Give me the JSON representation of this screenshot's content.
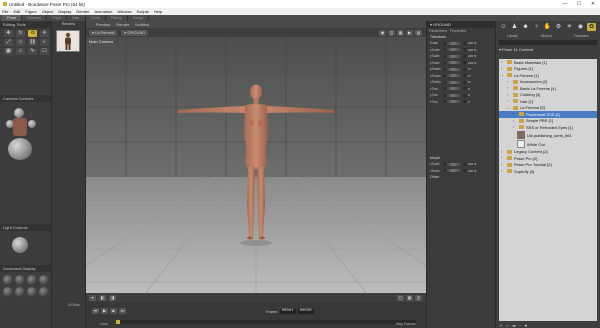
{
  "window": {
    "title": "Untitled - Bondware Poser Pro (64 bit)",
    "controls": [
      "—",
      "☐",
      "✕"
    ]
  },
  "menu": [
    "File",
    "Edit",
    "Figure",
    "Object",
    "Display",
    "Render",
    "Animation",
    "Window",
    "Scripts",
    "Help"
  ],
  "rooms": [
    "Pose",
    "Material",
    "Face",
    "Hair",
    "Cloth",
    "Fitting",
    "Setup"
  ],
  "left": {
    "editing_tools": "Editing Tools",
    "camera_controls": "Camera Controls",
    "light_controls": "Light Controls",
    "document_display": "Document Display"
  },
  "library_thumb_label": "Renders",
  "viewport": {
    "tabs": [
      "Preview",
      "Render",
      "Untitled"
    ],
    "figure": "La Femme",
    "body_part": "GROUND",
    "camera": "Main Camera",
    "frame_label": "Frame",
    "frame_value": "00001",
    "frame_total": "00030",
    "loop": "Loop",
    "skip": "Skip Frames",
    "ui_dots": "UI Dots"
  },
  "params": {
    "header": "GROUND",
    "tabs": [
      "Parameters",
      "Properties"
    ],
    "transform": "Transform",
    "rows": [
      {
        "label": "Scale",
        "value": "100 %"
      },
      {
        "label": "xScale",
        "value": "100 %"
      },
      {
        "label": "yScale",
        "value": "100 %"
      },
      {
        "label": "zScale",
        "value": "100 %"
      },
      {
        "label": "yRotate",
        "value": "0°"
      },
      {
        "label": "xRotate",
        "value": "0°"
      },
      {
        "label": "zRotate",
        "value": "0°"
      },
      {
        "label": "xTran",
        "value": "0"
      },
      {
        "label": "yTran",
        "value": "0"
      },
      {
        "label": "zTran",
        "value": "0"
      }
    ],
    "morph": "Morph",
    "morph_rows": [
      {
        "label": "xScale",
        "value": "100 %"
      },
      {
        "label": "zScale",
        "value": "100 %"
      }
    ],
    "other": "Other"
  },
  "library": {
    "tabs": [
      "Library",
      "Search",
      "Favorites"
    ],
    "root": "Poser 11 Content",
    "items": [
      {
        "label": "Basic Materials [1]",
        "indent": 0,
        "arrow": "›"
      },
      {
        "label": "Figures [1]",
        "indent": 0,
        "arrow": "›"
      },
      {
        "label": "La Femme [1]",
        "indent": 0,
        "arrow": "⌄"
      },
      {
        "label": "Accessories [2]",
        "indent": 1,
        "arrow": "›"
      },
      {
        "label": "Basic La Femme [4]",
        "indent": 1,
        "arrow": "›"
      },
      {
        "label": "Clothing [4]",
        "indent": 1,
        "arrow": "›"
      },
      {
        "label": "Hair [2]",
        "indent": 1,
        "arrow": "›"
      },
      {
        "label": "La Femme [5]",
        "indent": 1,
        "arrow": "⌄"
      },
      {
        "label": "Procedural SSS [1]",
        "indent": 2,
        "arrow": "›"
      },
      {
        "label": "Simple PBR [1]",
        "indent": 2,
        "arrow": "›"
      },
      {
        "label": "SSS or Refracted Eyes [1]",
        "indent": 2,
        "arrow": "›"
      },
      {
        "label": "LW-publishing_sorts_lbl4",
        "indent": 2,
        "arrow": "",
        "file": true
      },
      {
        "label": "White Out",
        "indent": 2,
        "arrow": "",
        "file": true
      },
      {
        "label": "Legacy Content [2]",
        "indent": 0,
        "arrow": "›"
      },
      {
        "label": "Poser Pro [2]",
        "indent": 0,
        "arrow": "›"
      },
      {
        "label": "Poser Pro Tutorial [2]",
        "indent": 0,
        "arrow": "›"
      },
      {
        "label": "Superfly [3]",
        "indent": 0,
        "arrow": "›"
      }
    ]
  }
}
